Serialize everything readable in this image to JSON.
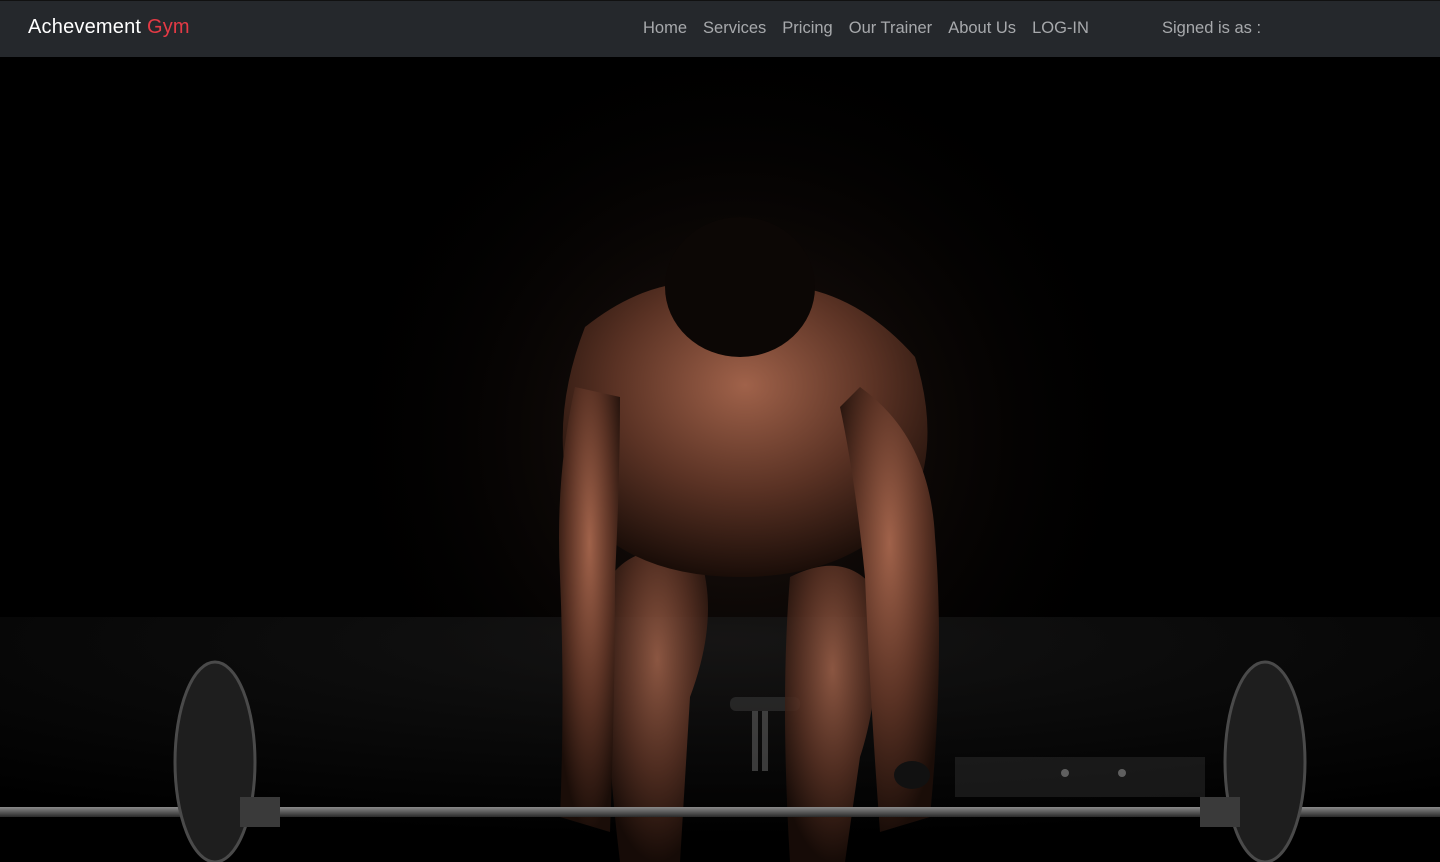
{
  "brand": {
    "name": "Achevement",
    "accent": "Gym",
    "accent_color": "#e43a45"
  },
  "nav": {
    "items": [
      {
        "label": "Home"
      },
      {
        "label": "Services"
      },
      {
        "label": "Pricing"
      },
      {
        "label": "Our Trainer"
      },
      {
        "label": "About Us"
      },
      {
        "label": "LOG-IN"
      }
    ],
    "signed_in": "Signed is as :"
  },
  "hero": {
    "image": "man-bending-over-barbell-in-dark-gym"
  },
  "colors": {
    "navbar_bg": "#25282c",
    "nav_text": "#a7a9ac",
    "hero_bg": "#000000"
  }
}
